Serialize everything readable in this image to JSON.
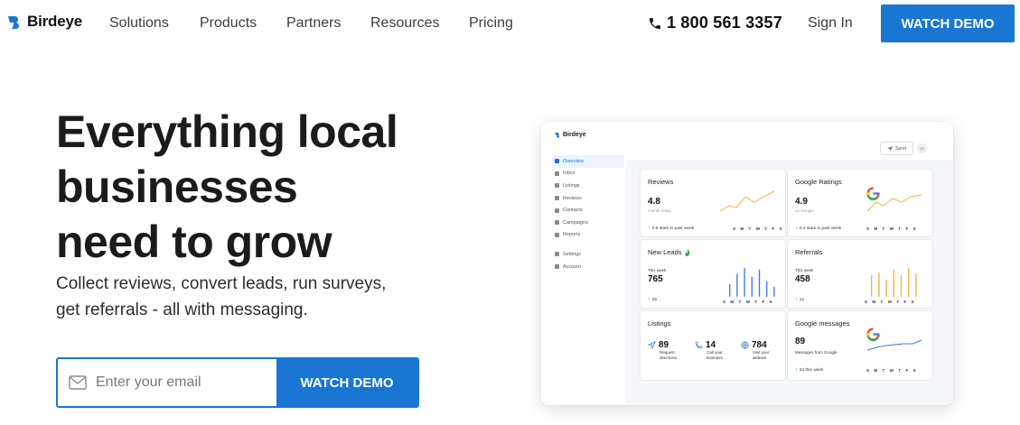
{
  "nav": {
    "brand": "Birdeye",
    "items": [
      "Solutions",
      "Products",
      "Partners",
      "Resources",
      "Pricing"
    ],
    "phone": "1 800 561 3357",
    "signin": "Sign In",
    "cta": "WATCH DEMO"
  },
  "hero": {
    "headline": [
      "Everything local",
      "businesses",
      "need to grow"
    ],
    "subtext": [
      "Collect reviews, convert leads, run surveys,",
      "get referrals - all with messaging."
    ],
    "email_placeholder": "Enter your email",
    "cta": "WATCH DEMO"
  },
  "colors": {
    "accent": "#1976d2",
    "chart_orange": "#f2b441",
    "chart_blue": "#3d7fde",
    "positive": "#2ca84a"
  },
  "dashboard": {
    "brand": "Birdeye",
    "sidebar": [
      "Overview",
      "Inbox",
      "Listings",
      "Reviews",
      "Contacts",
      "Campaigns",
      "Reports"
    ],
    "sidebar_bottom": [
      "Settings",
      "Account"
    ],
    "send_label": "Send",
    "avatar_initials": "JS",
    "days": [
      "S",
      "M",
      "T",
      "W",
      "T",
      "F",
      "S"
    ],
    "reviews": {
      "title": "Reviews",
      "value": "4.8",
      "caption": "overall rating",
      "change": "0.6 stars in past week"
    },
    "google_ratings": {
      "title": "Google Ratings",
      "value": "4.9",
      "caption": "on Google",
      "change": "0.4 stars in past week"
    },
    "new_leads": {
      "title": "New Leads",
      "period": "This week",
      "value": "765",
      "change": "25",
      "bars": [
        0.45,
        0.8,
        1.0,
        0.7,
        0.95,
        0.55,
        0.35
      ]
    },
    "referrals": {
      "title": "Referrals",
      "period": "This week",
      "value": "458",
      "change": "12",
      "bars": [
        0.75,
        0.85,
        0.6,
        0.95,
        0.75,
        1.0,
        0.8
      ]
    },
    "listings": {
      "title": "Listings",
      "stats": [
        {
          "icon": "navigation-icon",
          "value": "89",
          "label": [
            "Request",
            "directions"
          ]
        },
        {
          "icon": "phone-icon",
          "value": "14",
          "label": [
            "Call your",
            "business"
          ]
        },
        {
          "icon": "globe-icon",
          "value": "784",
          "label": [
            "Visit your",
            "website"
          ]
        }
      ]
    },
    "google_messages": {
      "title": "Google messages",
      "value": "89",
      "caption": "Messages from Google",
      "change": "34 this week"
    }
  }
}
